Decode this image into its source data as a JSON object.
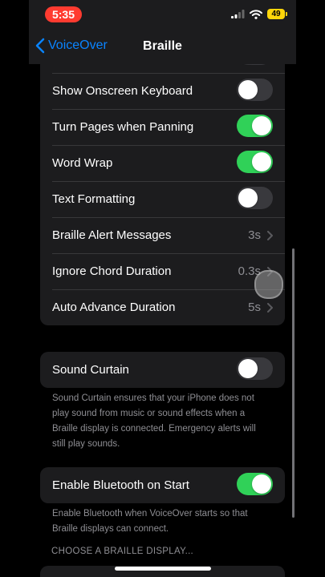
{
  "status": {
    "time": "5:35",
    "battery": "49"
  },
  "nav": {
    "back_label": "VoiceOver",
    "title": "Braille"
  },
  "braille_settings": {
    "rows": [
      {
        "label": "Show Onscreen Keyboard",
        "toggle": false
      },
      {
        "label": "Turn Pages when Panning",
        "toggle": true
      },
      {
        "label": "Word Wrap",
        "toggle": true
      },
      {
        "label": "Text Formatting",
        "toggle": false
      },
      {
        "label": "Braille Alert Messages",
        "value": "3s"
      },
      {
        "label": "Ignore Chord Duration",
        "value": "0.3s"
      },
      {
        "label": "Auto Advance Duration",
        "value": "5s"
      }
    ]
  },
  "sound_curtain": {
    "label": "Sound Curtain",
    "toggle": false,
    "footer": "Sound Curtain ensures that your iPhone does not play sound from music or sound effects when a Braille display is connected. Emergency alerts will still play sounds."
  },
  "bluetooth": {
    "label": "Enable Bluetooth on Start",
    "toggle": true,
    "footer": "Enable Bluetooth when VoiceOver starts so that Braille displays can connect."
  },
  "choose_display": {
    "header": "CHOOSE A BRAILLE DISPLAY..."
  },
  "colors": {
    "accent": "#0a84ff",
    "toggle_on": "#30d158",
    "status_pill": "#ff3b30",
    "battery": "#ffd60a"
  }
}
